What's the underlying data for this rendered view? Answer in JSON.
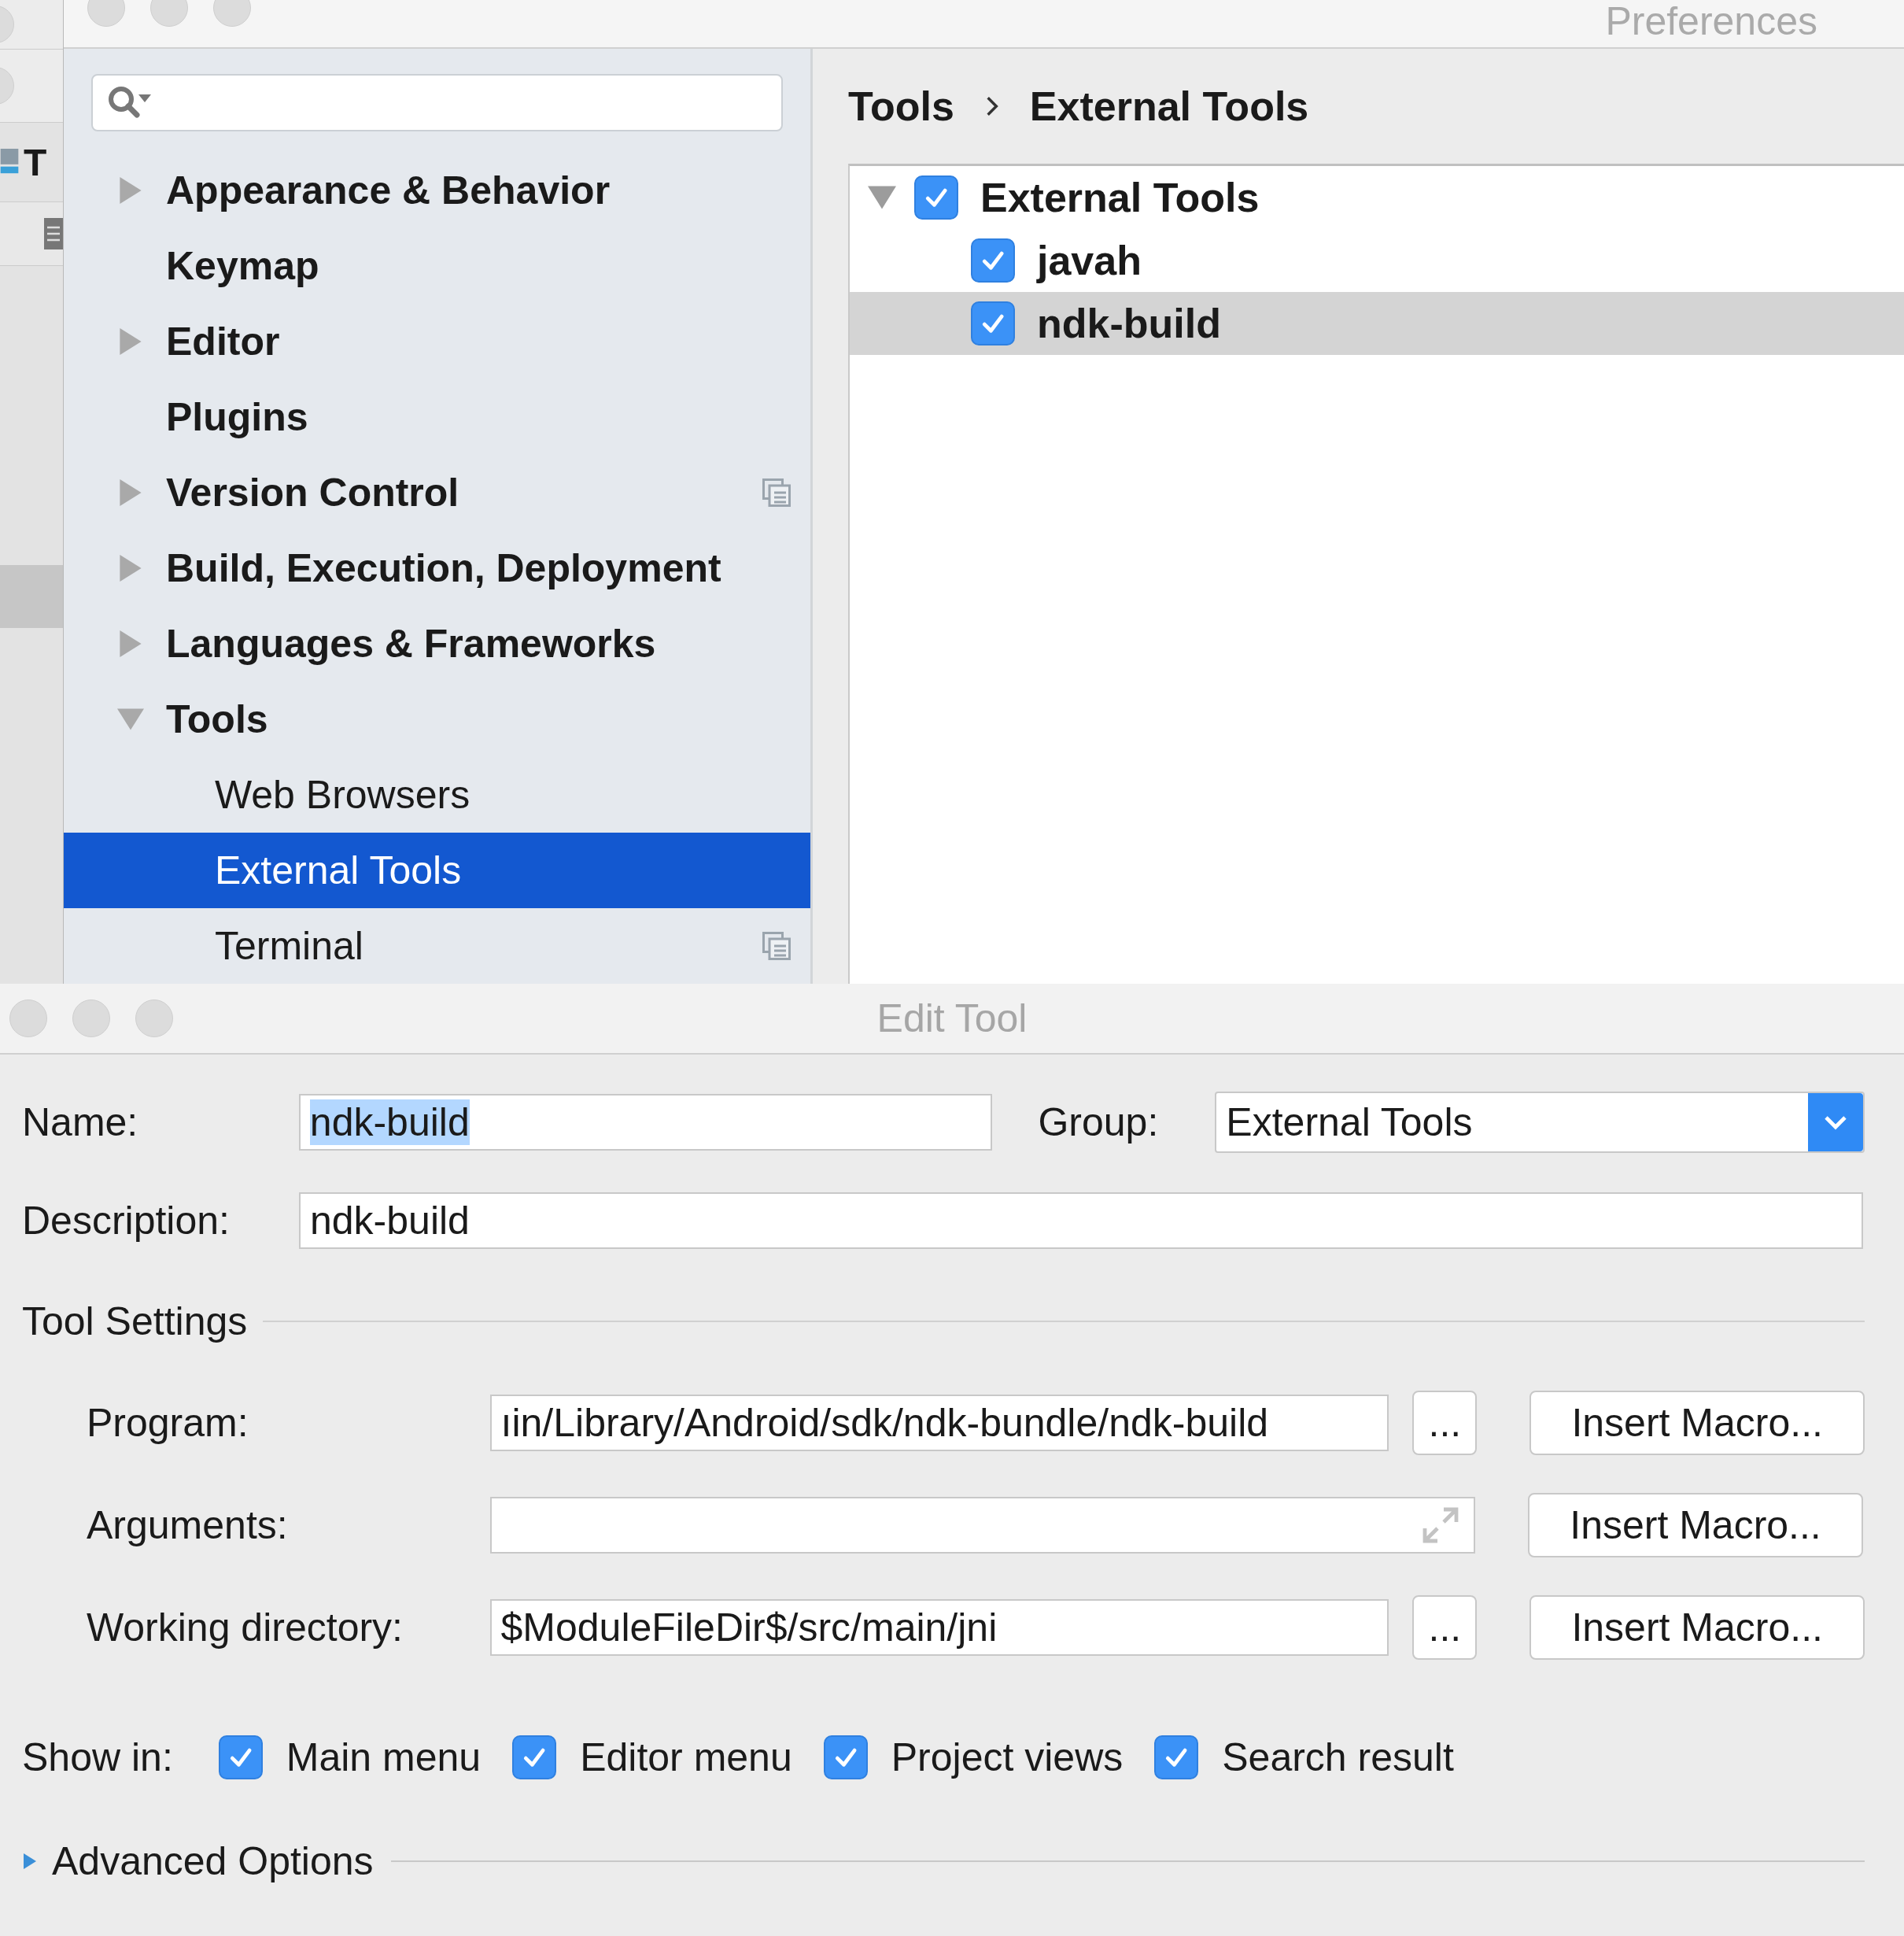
{
  "background_window": {
    "title_fragment": "T"
  },
  "preferences": {
    "title": "Preferences",
    "sidebar": {
      "items": [
        {
          "label": "Appearance & Behavior",
          "kind": "group",
          "expanded": false,
          "selected": false,
          "project_scoped": false
        },
        {
          "label": "Keymap",
          "kind": "page",
          "selected": false,
          "project_scoped": false
        },
        {
          "label": "Editor",
          "kind": "group",
          "expanded": false,
          "selected": false,
          "project_scoped": false
        },
        {
          "label": "Plugins",
          "kind": "page",
          "selected": false,
          "project_scoped": false
        },
        {
          "label": "Version Control",
          "kind": "group",
          "expanded": false,
          "selected": false,
          "project_scoped": true
        },
        {
          "label": "Build, Execution, Deployment",
          "kind": "group",
          "expanded": false,
          "selected": false,
          "project_scoped": false
        },
        {
          "label": "Languages & Frameworks",
          "kind": "group",
          "expanded": false,
          "selected": false,
          "project_scoped": false
        },
        {
          "label": "Tools",
          "kind": "group",
          "expanded": true,
          "selected": false,
          "project_scoped": false,
          "children": [
            {
              "label": "Web Browsers",
              "selected": false,
              "project_scoped": false
            },
            {
              "label": "External Tools",
              "selected": true,
              "project_scoped": false
            },
            {
              "label": "Terminal",
              "selected": false,
              "project_scoped": true
            }
          ]
        }
      ]
    },
    "breadcrumb": [
      "Tools",
      "External Tools"
    ],
    "tree": [
      {
        "label": "External Tools",
        "checked": true,
        "expanded": true,
        "selected": false,
        "children": [
          {
            "label": "javah",
            "checked": true,
            "selected": false
          },
          {
            "label": "ndk-build",
            "checked": true,
            "selected": true
          }
        ]
      }
    ]
  },
  "edit_tool": {
    "title": "Edit Tool",
    "name": {
      "label": "Name:",
      "value": "ndk-build",
      "text_selected": true
    },
    "group": {
      "label": "Group:",
      "value": "External Tools"
    },
    "description": {
      "label": "Description:",
      "value": "ndk-build"
    },
    "tool_settings": {
      "title": "Tool Settings",
      "rows": [
        {
          "label": "Program:",
          "kind": "browse",
          "value": "ıin/Library/Android/sdk/ndk-bundle/ndk-build",
          "browse_button": "...",
          "macro_button": "Insert Macro..."
        },
        {
          "label": "Arguments:",
          "kind": "expandable",
          "macro_button": "Insert Macro..."
        },
        {
          "label": "Working directory:",
          "kind": "browse",
          "value": "$ModuleFileDir$/src/main/jni",
          "browse_button": "...",
          "macro_button": "Insert Macro..."
        }
      ]
    },
    "show_in": {
      "label": "Show in:",
      "options": [
        {
          "label": "Main menu",
          "checked": true
        },
        {
          "label": "Editor menu",
          "checked": true
        },
        {
          "label": "Project views",
          "checked": true
        },
        {
          "label": "Search result",
          "checked": true
        }
      ]
    },
    "advanced": {
      "label": "Advanced Options",
      "expanded": false
    }
  }
}
